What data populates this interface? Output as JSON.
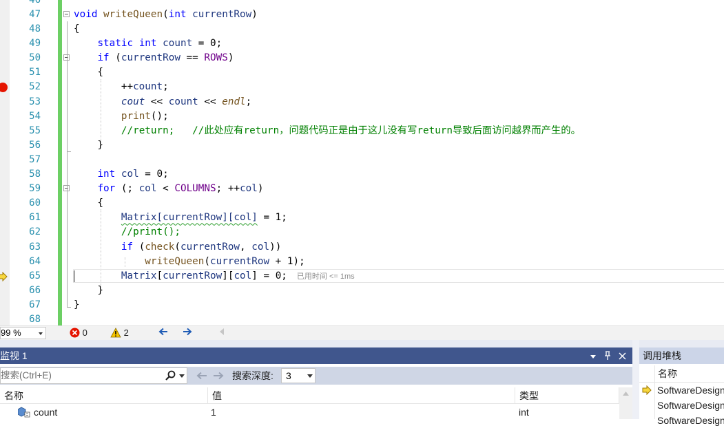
{
  "editor": {
    "lines": [
      {
        "num": "46",
        "tokens": []
      },
      {
        "num": "47",
        "fold": true,
        "tokens": [
          {
            "t": "void",
            "c": "kw"
          },
          {
            "t": " "
          },
          {
            "t": "writeQueen",
            "c": "fn"
          },
          {
            "t": "("
          },
          {
            "t": "int",
            "c": "kw"
          },
          {
            "t": " "
          },
          {
            "t": "currentRow",
            "c": "var"
          },
          {
            "t": ")"
          }
        ]
      },
      {
        "num": "48",
        "tokens": [
          {
            "t": "{"
          }
        ]
      },
      {
        "num": "49",
        "tokens": [
          {
            "t": "    "
          },
          {
            "t": "static",
            "c": "kw"
          },
          {
            "t": " "
          },
          {
            "t": "int",
            "c": "kw"
          },
          {
            "t": " "
          },
          {
            "t": "count",
            "c": "var"
          },
          {
            "t": " = 0;"
          }
        ]
      },
      {
        "num": "50",
        "fold": true,
        "tokens": [
          {
            "t": "    "
          },
          {
            "t": "if",
            "c": "kw"
          },
          {
            "t": " ("
          },
          {
            "t": "currentRow",
            "c": "var"
          },
          {
            "t": " == "
          },
          {
            "t": "ROWS",
            "c": "macro"
          },
          {
            "t": ")"
          }
        ]
      },
      {
        "num": "51",
        "tokens": [
          {
            "t": "    {"
          }
        ]
      },
      {
        "num": "52",
        "tokens": [
          {
            "t": "        ++"
          },
          {
            "t": "count",
            "c": "var"
          },
          {
            "t": ";"
          }
        ]
      },
      {
        "num": "53",
        "tokens": [
          {
            "t": "        "
          },
          {
            "t": "cout",
            "c": "var it"
          },
          {
            "t": " << "
          },
          {
            "t": "count",
            "c": "var"
          },
          {
            "t": " << "
          },
          {
            "t": "endl",
            "c": "fn it"
          },
          {
            "t": ";"
          }
        ]
      },
      {
        "num": "54",
        "tokens": [
          {
            "t": "        "
          },
          {
            "t": "print",
            "c": "fn"
          },
          {
            "t": "();"
          }
        ]
      },
      {
        "num": "55",
        "tokens": [
          {
            "t": "        "
          },
          {
            "t": "//return;   //此处应有return，问题代码正是由于这儿没有写return导致后面访问越界而产生的。",
            "c": "cmt"
          }
        ]
      },
      {
        "num": "56",
        "tokens": [
          {
            "t": "    }"
          }
        ]
      },
      {
        "num": "57",
        "tokens": []
      },
      {
        "num": "58",
        "tokens": [
          {
            "t": "    "
          },
          {
            "t": "int",
            "c": "kw"
          },
          {
            "t": " "
          },
          {
            "t": "col",
            "c": "var"
          },
          {
            "t": " = 0;"
          }
        ]
      },
      {
        "num": "59",
        "fold": true,
        "tokens": [
          {
            "t": "    "
          },
          {
            "t": "for",
            "c": "kw"
          },
          {
            "t": " (; "
          },
          {
            "t": "col",
            "c": "var"
          },
          {
            "t": " < "
          },
          {
            "t": "COLUMNS",
            "c": "macro"
          },
          {
            "t": "; ++"
          },
          {
            "t": "col",
            "c": "var"
          },
          {
            "t": ")"
          }
        ]
      },
      {
        "num": "60",
        "tokens": [
          {
            "t": "    {"
          }
        ]
      },
      {
        "num": "61",
        "tokens": [
          {
            "t": "        "
          },
          {
            "t": "Matrix[currentRow][col]",
            "c": "var squig"
          },
          {
            "t": " = 1;"
          }
        ]
      },
      {
        "num": "62",
        "tokens": [
          {
            "t": "        "
          },
          {
            "t": "//print();",
            "c": "cmt"
          }
        ]
      },
      {
        "num": "63",
        "tokens": [
          {
            "t": "        "
          },
          {
            "t": "if",
            "c": "kw"
          },
          {
            "t": " ("
          },
          {
            "t": "check",
            "c": "fn"
          },
          {
            "t": "("
          },
          {
            "t": "currentRow",
            "c": "var"
          },
          {
            "t": ", "
          },
          {
            "t": "col",
            "c": "var"
          },
          {
            "t": "))"
          }
        ]
      },
      {
        "num": "64",
        "tokens": [
          {
            "t": "            "
          },
          {
            "t": "writeQueen",
            "c": "fn"
          },
          {
            "t": "("
          },
          {
            "t": "currentRow",
            "c": "var"
          },
          {
            "t": " + 1);"
          }
        ]
      },
      {
        "num": "65",
        "tokens": [
          {
            "t": "        "
          },
          {
            "t": "Matrix",
            "c": "var"
          },
          {
            "t": "["
          },
          {
            "t": "currentRow",
            "c": "var"
          },
          {
            "t": "]["
          },
          {
            "t": "col",
            "c": "var"
          },
          {
            "t": "] = 0;"
          }
        ],
        "perf": "已用时间 <= 1ms"
      },
      {
        "num": "66",
        "tokens": [
          {
            "t": "    }"
          }
        ]
      },
      {
        "num": "67",
        "tokens": [
          {
            "t": "}"
          }
        ]
      },
      {
        "num": "68",
        "tokens": []
      }
    ]
  },
  "status": {
    "zoom": "99 %",
    "errors": "0",
    "warnings": "2"
  },
  "watch": {
    "title": "监视 1",
    "search_placeholder": "搜索(Ctrl+E)",
    "depth_label": "搜索深度:",
    "depth_value": "3",
    "columns": [
      "名称",
      "值",
      "类型"
    ],
    "rows": [
      {
        "name": "count",
        "value": "1",
        "type": "int"
      }
    ]
  },
  "callstack": {
    "title": "调用堆栈",
    "column": "名称",
    "rows": [
      "SoftwareDesign",
      "SoftwareDesign",
      "SoftwareDesign"
    ]
  },
  "colors": {
    "keyword": "#0000ff",
    "function": "#74531f",
    "variable": "#1f377f",
    "macro": "#6f008a",
    "comment": "#008000",
    "panel_title_active": "#40568d",
    "breakpoint": "#e51400",
    "change_bar": "#6ccf64"
  }
}
